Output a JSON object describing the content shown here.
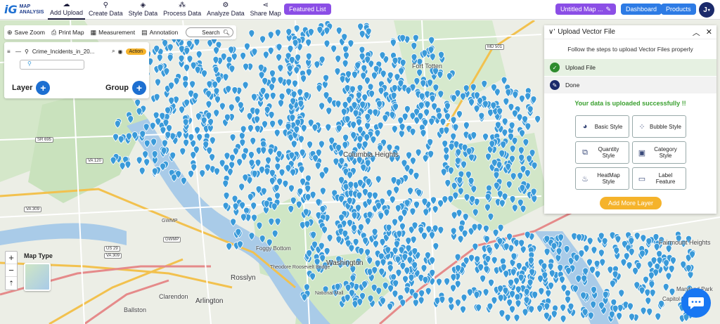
{
  "app": {
    "logo_mark": "iG",
    "logo_line1": "MAP",
    "logo_line2": "ANALYSIS"
  },
  "nav": [
    {
      "label": "Add Upload",
      "icon": "cloud-upload-icon",
      "glyph": "☁",
      "active": true
    },
    {
      "label": "Create Data",
      "icon": "pin-icon",
      "glyph": "⚲",
      "active": false
    },
    {
      "label": "Style Data",
      "icon": "paint-bucket-icon",
      "glyph": "◈",
      "active": false
    },
    {
      "label": "Process Data",
      "icon": "process-icon",
      "glyph": "⁂",
      "active": false
    },
    {
      "label": "Analyze Data",
      "icon": "analyze-icon",
      "glyph": "⚙",
      "active": false
    },
    {
      "label": "Share Map",
      "icon": "share-icon",
      "glyph": "⋖",
      "active": false
    }
  ],
  "header": {
    "featured": "Featured List",
    "map_name": "Untitled Map ...",
    "dashboard": "Dashboard",
    "products": "Products",
    "user_initial": "J"
  },
  "tools": {
    "save_zoom": "Save Zoom",
    "print_map": "Print Map",
    "measurement": "Measurement",
    "annotation": "Annotation",
    "search": "Search"
  },
  "layers": {
    "layer_name": "Crime_Incidents_in_20...",
    "action": "Action",
    "layer_label": "Layer",
    "group_label": "Group"
  },
  "map": {
    "type_label": "Map Type",
    "labels": [
      "Columbia Heights",
      "Rosslyn",
      "Arlington",
      "Washington",
      "Clarendon",
      "Ballston",
      "Fort Totten",
      "Fairmount Heights",
      "Theodore Roosevelt Bridge",
      "National Mall",
      "Foggy Bottom",
      "GWMP",
      "Maryland Park",
      "Capitol Heights"
    ],
    "shields": [
      "MD 501",
      "VA 120",
      "SR 695",
      "VA 309",
      "US 29",
      "VA 309",
      "GWMP"
    ],
    "pin_color": "#3a9ad9"
  },
  "upload_panel": {
    "title": "Upload Vector File",
    "subtitle": "Follow the steps to upload Vector Files properly",
    "steps": [
      {
        "label": "Upload File",
        "state": "complete"
      },
      {
        "label": "Done",
        "state": "current"
      }
    ],
    "success": "Your data is uploaded successfully !!",
    "style_buttons": [
      {
        "label": "Basic Style",
        "icon": "basic-style-icon"
      },
      {
        "label": "Bubble Style",
        "icon": "bubble-style-icon"
      },
      {
        "label": "Quantity Style",
        "icon": "quantity-style-icon"
      },
      {
        "label": "Category Style",
        "icon": "category-style-icon"
      },
      {
        "label": "HeatMap Style",
        "icon": "heatmap-style-icon"
      },
      {
        "label": "Label Feature",
        "icon": "label-feature-icon"
      }
    ],
    "add_more": "Add More Layer",
    "accent": "#f5b32b",
    "success_color": "#3aa02f"
  }
}
